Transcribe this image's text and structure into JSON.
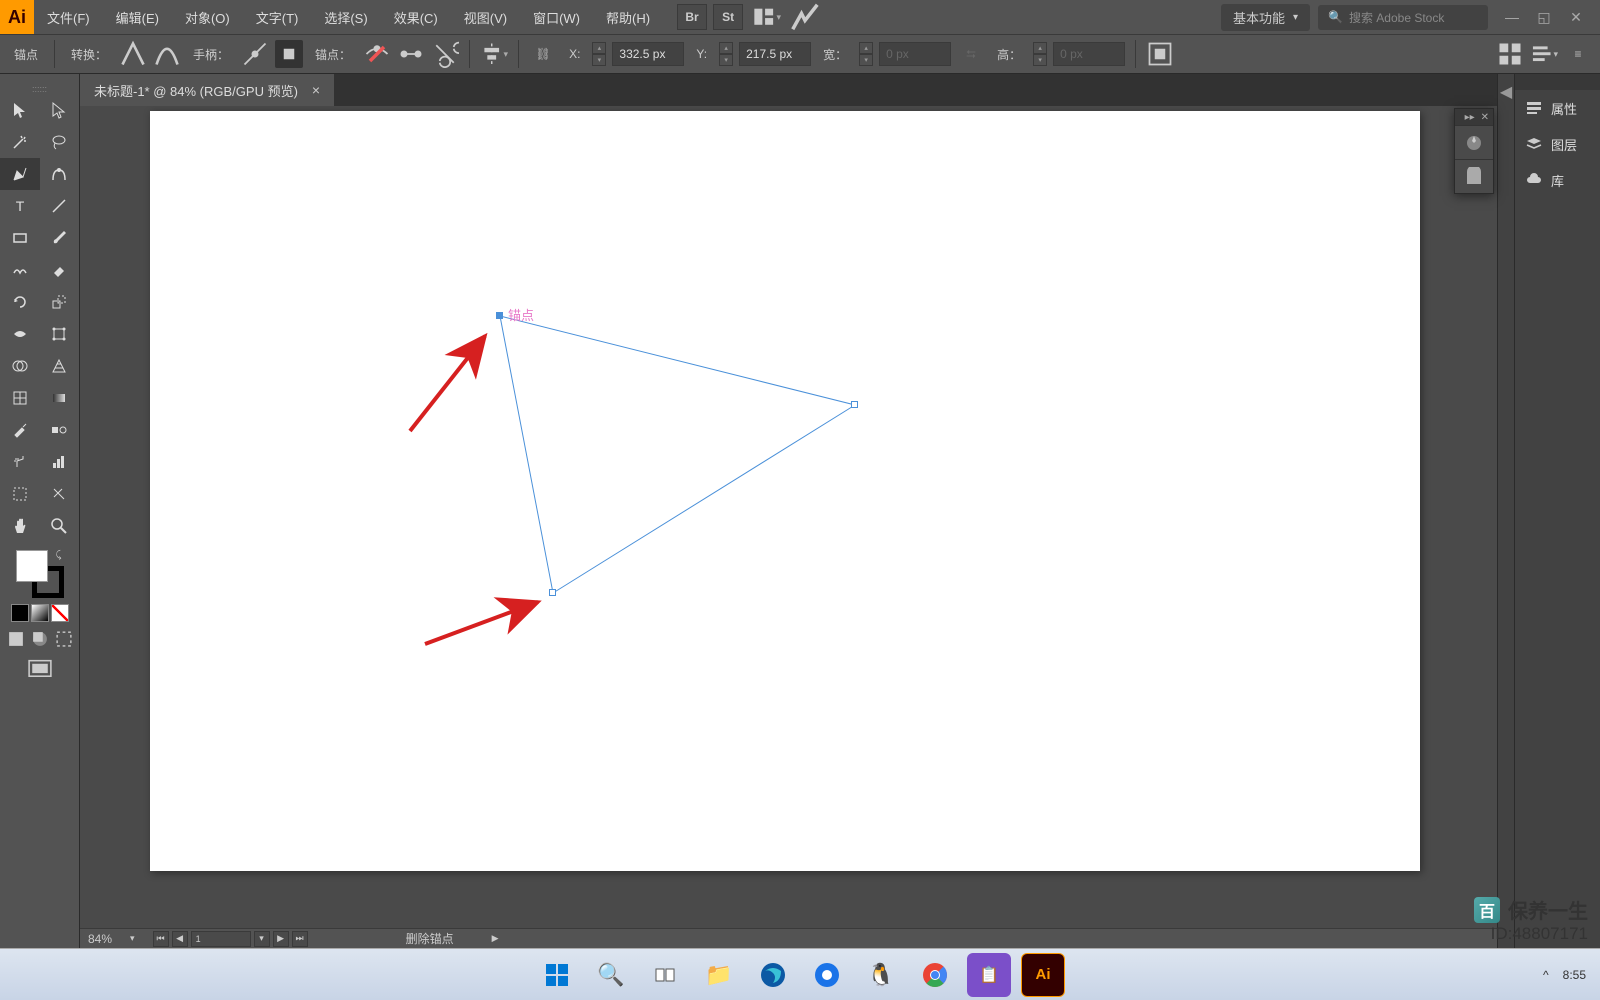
{
  "menubar": {
    "items": [
      "文件(F)",
      "编辑(E)",
      "对象(O)",
      "文字(T)",
      "选择(S)",
      "效果(C)",
      "视图(V)",
      "窗口(W)",
      "帮助(H)"
    ],
    "br": "Br",
    "st": "St",
    "workspace": "基本功能",
    "search_placeholder": "搜索 Adobe Stock"
  },
  "ctrlbar": {
    "mode": "锚点",
    "convert": "转换：",
    "handle": "手柄：",
    "anchors": "锚点：",
    "x_label": "X:",
    "x_val": "332.5 px",
    "y_label": "Y:",
    "y_val": "217.5 px",
    "w_label": "宽：",
    "w_val": "0 px",
    "h_label": "高：",
    "h_val": "0 px"
  },
  "tab": {
    "title": "未标题-1* @ 84% (RGB/GPU 预览)"
  },
  "status": {
    "zoom": "84%",
    "artboard": "1",
    "tool": "删除锚点"
  },
  "rightpanel": {
    "p1": "属性",
    "p2": "图层",
    "p3": "库"
  },
  "canvas": {
    "anchor_label": "锚点"
  },
  "watermark": {
    "line1": "保养一生",
    "line2": "ID:48807171"
  },
  "tray": {
    "time": "8:55"
  }
}
